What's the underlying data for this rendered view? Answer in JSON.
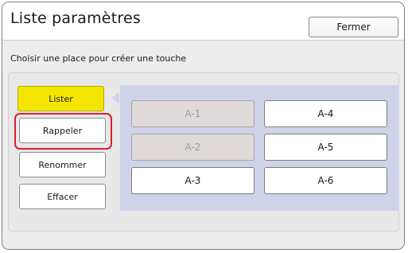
{
  "window": {
    "title": "Liste paramètres",
    "close_label": "Fermer"
  },
  "instruction": "Choisir une place pour créer une touche",
  "menu": {
    "items": [
      {
        "label": "Lister",
        "state": "selected"
      },
      {
        "label": "Rappeler",
        "state": "highlighted"
      },
      {
        "label": "Renommer",
        "state": "normal"
      },
      {
        "label": "Effacer",
        "state": "normal"
      }
    ]
  },
  "keys": [
    {
      "label": "A-1",
      "enabled": false
    },
    {
      "label": "A-2",
      "enabled": false
    },
    {
      "label": "A-3",
      "enabled": true
    },
    {
      "label": "A-4",
      "enabled": true
    },
    {
      "label": "A-5",
      "enabled": true
    },
    {
      "label": "A-6",
      "enabled": true
    }
  ],
  "colors": {
    "selected_button": "#f4e600",
    "highlight_ring": "#e11d2c",
    "key_panel": "#cfd3ea",
    "disabled_key": "#dfd9d9"
  }
}
